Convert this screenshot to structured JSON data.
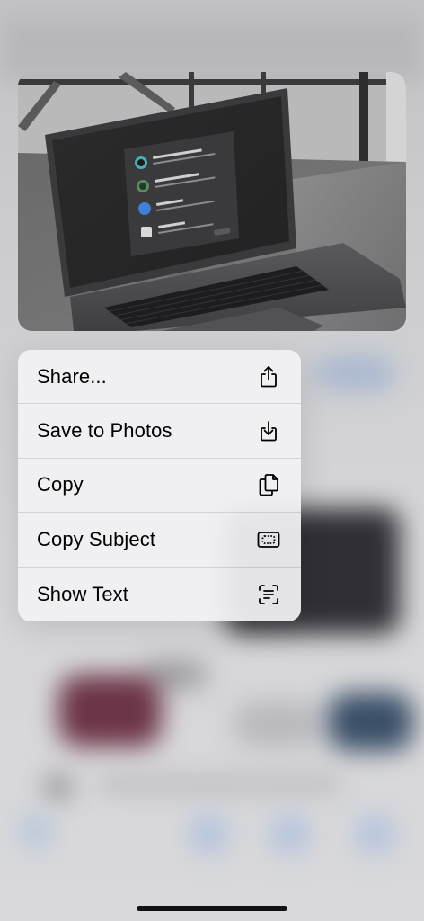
{
  "context_menu": {
    "items": [
      {
        "label": "Share...",
        "icon": "share-icon"
      },
      {
        "label": "Save to Photos",
        "icon": "save-download-icon"
      },
      {
        "label": "Copy",
        "icon": "copy-icon"
      },
      {
        "label": "Copy Subject",
        "icon": "copy-subject-icon"
      },
      {
        "label": "Show Text",
        "icon": "live-text-icon"
      }
    ]
  },
  "preview": {
    "content": "laptop-recovery-screen-photo"
  },
  "colors": {
    "menu_background": "#f2f2f4",
    "menu_text": "#000000",
    "separator": "#d6d6d9",
    "laptop_body": "#4a4a4c",
    "screen": "#2a2a2a",
    "home_indicator": "#111111"
  }
}
